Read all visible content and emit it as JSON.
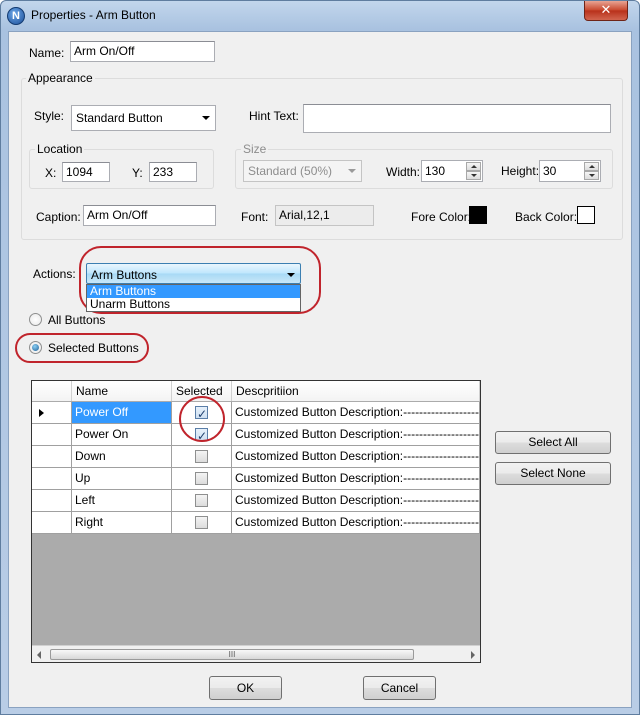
{
  "window": {
    "title": "Properties - Arm Button",
    "app_icon_glyph": "N",
    "close_glyph": "✕"
  },
  "name": {
    "label": "Name:",
    "value": "Arm On/Off"
  },
  "appearance": {
    "title": "Appearance",
    "style_label": "Style:",
    "style_value": "Standard Button",
    "hint_label": "Hint Text:",
    "hint_value": "",
    "location": {
      "title": "Location",
      "x_label": "X:",
      "x_value": "1094",
      "y_label": "Y:",
      "y_value": "233"
    },
    "size": {
      "title": "Size",
      "preset_value": "Standard   (50%)",
      "width_label": "Width:",
      "width_value": "130",
      "height_label": "Height:",
      "height_value": "30"
    },
    "caption_label": "Caption:",
    "caption_value": "Arm On/Off",
    "font_label": "Font:",
    "font_value": "Arial,12,1",
    "fore_color_label": "Fore Color:",
    "fore_color": "#000000",
    "back_color_label": "Back Color:",
    "back_color": "#ffffff"
  },
  "actions": {
    "label": "Actions:",
    "selected": "Arm Buttons",
    "options": [
      "Arm Buttons",
      "Unarm Buttons"
    ]
  },
  "filter": {
    "all_label": "All Buttons",
    "selected_label": "Selected Buttons",
    "selected_option": "selected"
  },
  "grid": {
    "columns": [
      "Name",
      "Selected",
      "Descpritiion"
    ],
    "rows": [
      {
        "name": "Power Off",
        "selected": true,
        "description": "Customized Button Description:--------------------Name:",
        "current": true
      },
      {
        "name": "Power On",
        "selected": true,
        "description": "Customized Button Description:--------------------Name:",
        "current": false
      },
      {
        "name": "Down",
        "selected": false,
        "description": "Customized Button Description:--------------------Name:",
        "current": false
      },
      {
        "name": "Up",
        "selected": false,
        "description": "Customized Button Description:--------------------Name:",
        "current": false
      },
      {
        "name": "Left",
        "selected": false,
        "description": "Customized Button Description:--------------------Name:",
        "current": false
      },
      {
        "name": "Right",
        "selected": false,
        "description": "Customized Button Description:--------------------Name:",
        "current": false
      }
    ],
    "scroll_thumb_glyph": "III"
  },
  "buttons": {
    "select_all": "Select All",
    "select_none": "Select None",
    "ok": "OK",
    "cancel": "Cancel"
  },
  "colors": {
    "highlight_annotation": "#c0242c",
    "selection": "#3399ff"
  }
}
